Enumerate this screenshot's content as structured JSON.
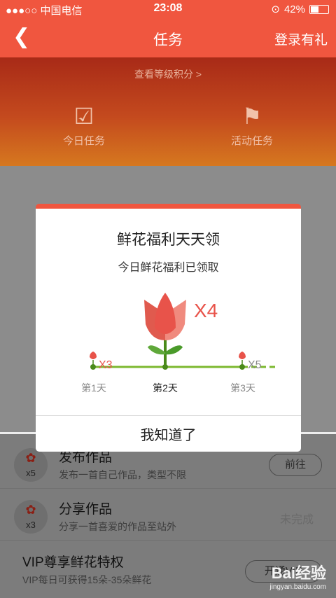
{
  "status_bar": {
    "carrier": "●●●○○ 中国电信",
    "time": "23:08",
    "battery": "42%",
    "battery_level": 0.42
  },
  "nav": {
    "back_icon": "chevron-left-icon",
    "title": "任务",
    "right": "登录有礼"
  },
  "hero": {
    "link": "查看等级积分 >",
    "tabs": [
      {
        "label": "今日任务",
        "icon": "clipboard-check-icon"
      },
      {
        "label": "活动任务",
        "icon": "flag-icon"
      }
    ]
  },
  "tasks": [
    {
      "badge": "x5",
      "name": "发布作品",
      "desc": "发布一首自己作品，类型不限",
      "action": "前往"
    },
    {
      "badge": "x3",
      "name": "分享作品",
      "desc": "分享一首喜爱的作品至站外",
      "action": "未完成"
    },
    {
      "name": "VIP尊享鲜花特权",
      "desc": "VIP每日可获得15朵-35朵鲜花",
      "action": "开通VIP"
    }
  ],
  "modal": {
    "title": "鲜花福利天天领",
    "subtitle": "今日鲜花福利已领取",
    "days": [
      {
        "label": "第1天",
        "mult": "X3"
      },
      {
        "label": "第2天",
        "mult": "X4"
      },
      {
        "label": "第3天",
        "mult": "X5"
      }
    ],
    "confirm": "我知道了"
  },
  "watermark": {
    "brand": "Bai经验",
    "url": "jingyan.baidu.com"
  },
  "colors": {
    "accent": "#f0563f",
    "rose": "#e8534a",
    "leaf": "#7cb82f"
  }
}
